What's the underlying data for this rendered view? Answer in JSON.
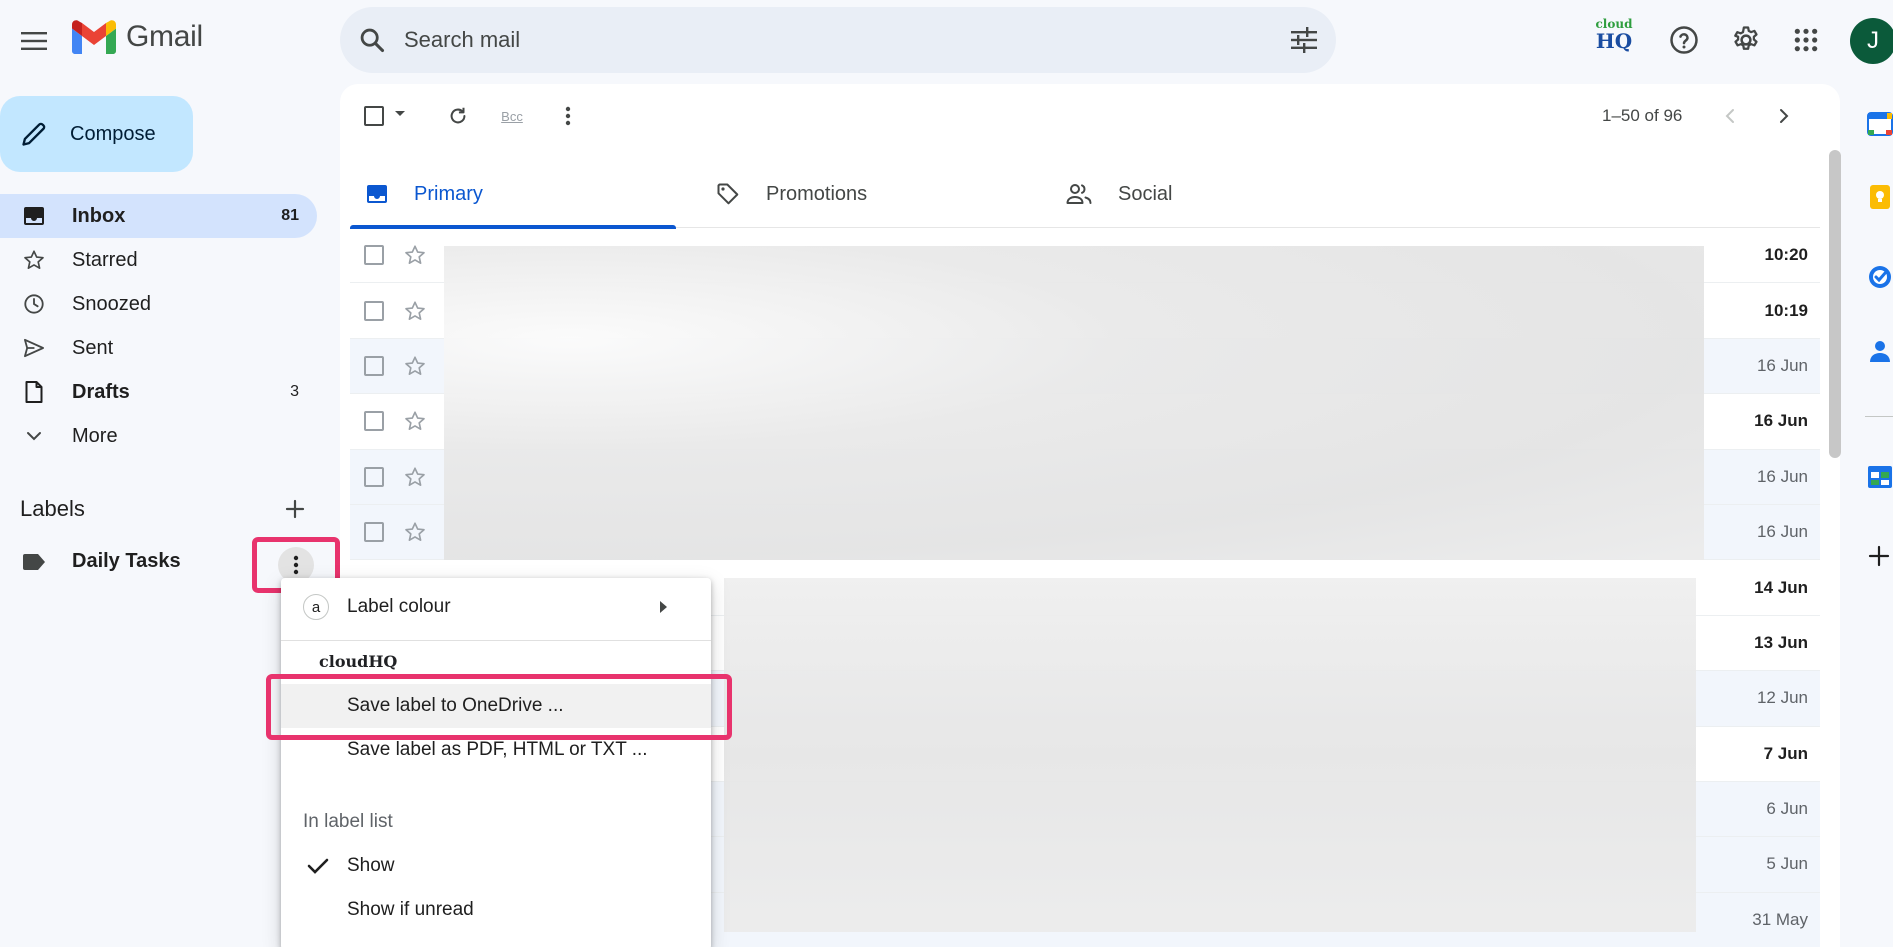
{
  "header": {
    "app_name": "Gmail",
    "search_placeholder": "Search mail",
    "cloudhq_top": "cloud",
    "cloudhq_bottom": "HQ",
    "avatar_letter": "J"
  },
  "sidebar": {
    "compose_label": "Compose",
    "items": [
      {
        "label": "Inbox",
        "count": "81",
        "icon": "inbox-icon"
      },
      {
        "label": "Starred",
        "count": "",
        "icon": "star-icon"
      },
      {
        "label": "Snoozed",
        "count": "",
        "icon": "clock-icon"
      },
      {
        "label": "Sent",
        "count": "",
        "icon": "send-icon"
      },
      {
        "label": "Drafts",
        "count": "3",
        "icon": "file-icon"
      },
      {
        "label": "More",
        "count": "",
        "icon": "chevron-down-icon"
      }
    ],
    "labels_heading": "Labels",
    "labels": [
      {
        "name": "Daily Tasks",
        "color": "#444746"
      }
    ]
  },
  "toolbar": {
    "pagination": "1–50 of 96",
    "bcc_glyph": "Bcc"
  },
  "tabs": [
    {
      "label": "Primary",
      "active": true
    },
    {
      "label": "Promotions",
      "active": false
    },
    {
      "label": "Social",
      "active": false
    }
  ],
  "emails": [
    {
      "time": "10:20",
      "unread": true
    },
    {
      "time": "10:19",
      "unread": true
    },
    {
      "time": "16 Jun",
      "unread": false
    },
    {
      "time": "16 Jun",
      "unread": true
    },
    {
      "time": "16 Jun",
      "unread": false
    },
    {
      "time": "16 Jun",
      "unread": false
    },
    {
      "time": "14 Jun",
      "unread": true
    },
    {
      "time": "13 Jun",
      "unread": true
    },
    {
      "time": "12 Jun",
      "unread": false
    },
    {
      "time": "7 Jun",
      "unread": true
    },
    {
      "time": "6 Jun",
      "unread": false
    },
    {
      "time": "5 Jun",
      "unread": false
    },
    {
      "time": "31 May",
      "unread": false
    }
  ],
  "context_menu": {
    "swatch_letter": "a",
    "label_colour": "Label colour",
    "cloudhq_brand": "cloudHQ",
    "save_onedrive": "Save label to OneDrive ...",
    "save_pdf": "Save label as PDF, HTML or TXT ...",
    "section_label_list": "In label list",
    "show": "Show",
    "show_if_unread": "Show if unread"
  },
  "colors": {
    "accent_blue": "#0b57d0",
    "highlight_pink": "#e8336d",
    "compose_bg": "#c2e7ff",
    "active_nav_bg": "#d3e3fd"
  }
}
